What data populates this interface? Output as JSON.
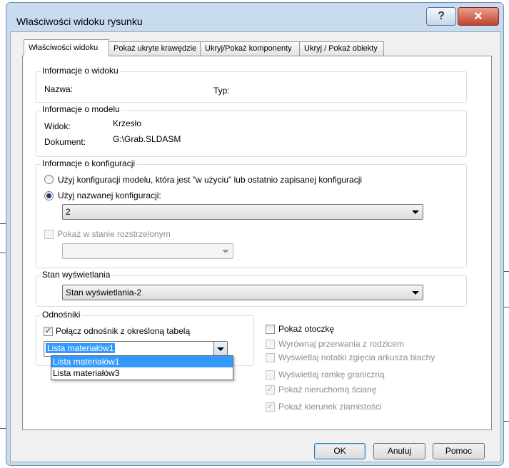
{
  "dialog": {
    "title": "Właściwości widoku rysunku",
    "help_label": "?",
    "close_label": "✕"
  },
  "tabs": [
    {
      "label": "Właściwości widoku",
      "active": true
    },
    {
      "label": "Pokaż ukryte krawędzie",
      "active": false
    },
    {
      "label": "Ukryj/Pokaż komponenty",
      "active": false
    },
    {
      "label": "Ukryj / Pokaż obiekty",
      "active": false
    }
  ],
  "view_info": {
    "title": "Informacje o widoku",
    "name_label": "Nazwa:",
    "type_label": "Typ:"
  },
  "model_info": {
    "title": "Informacje o modelu",
    "view_label": "Widok:",
    "view_value": "Krzesło",
    "document_label": "Dokument:",
    "document_value": "G:\\Grab.SLDASM"
  },
  "config_info": {
    "title": "Informacje o konfiguracji",
    "option_model_config": "Użyj konfiguracji modelu, która jest \"w użyciu\" lub ostatnio zapisanej konfiguracji",
    "option_named_config": "Użyj nazwanej konfiguracji:",
    "selected_option": "named",
    "named_config_value": "2",
    "exploded_label": "Pokaż w stanie rozstrzelonym",
    "exploded_value": ""
  },
  "display_state": {
    "title": "Stan wyświetlania",
    "value": "Stan wyświetlania-2"
  },
  "references": {
    "title": "Odnośniki",
    "link_checkbox_label": "Połącz odnośnik z określoną tabelą",
    "link_checked": true,
    "table_value": "Lista materiałów1",
    "options": [
      "Lista materiałów1",
      "Lista materiałów3"
    ]
  },
  "right_options": {
    "show_envelope": "Pokaż otoczkę",
    "align_breaks": "Wyrównaj przerwania z rodzicem",
    "sheet_metal_notes": "Wyświetlaj notatki zgięcia arkusza blachy",
    "bounding_box": "Wyświetlaj ramkę graniczną",
    "fixed_face": "Pokaż nieruchomą ścianę",
    "grain_direction": "Pokaż kierunek ziarnistości"
  },
  "buttons": {
    "ok": "OK",
    "cancel": "Anuluj",
    "help": "Pomoc"
  }
}
